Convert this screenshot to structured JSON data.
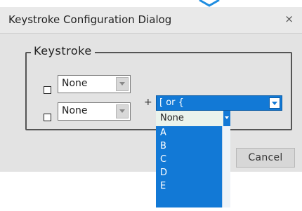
{
  "dialog": {
    "title": "Keystroke Configuration Dialog",
    "close_glyph": "×"
  },
  "group": {
    "legend": "Keystroke"
  },
  "modifiers": [
    {
      "checked": false,
      "value": "None"
    },
    {
      "checked": false,
      "value": "None"
    }
  ],
  "plus": "+",
  "key_combo": {
    "value": "[ or {"
  },
  "dropdown": {
    "items": [
      "None",
      "A",
      "B",
      "C",
      "D",
      "E"
    ],
    "selected_index": 0
  },
  "buttons": {
    "cancel": "Cancel"
  },
  "colors": {
    "accent": "#1279d6",
    "dialog_bg": "#e3e3e3",
    "arrow_decoration": "#1f8de0"
  },
  "icons": {
    "close": "close-icon",
    "dropdown": "chevron-down-icon",
    "decoration": "arrow-icon"
  }
}
